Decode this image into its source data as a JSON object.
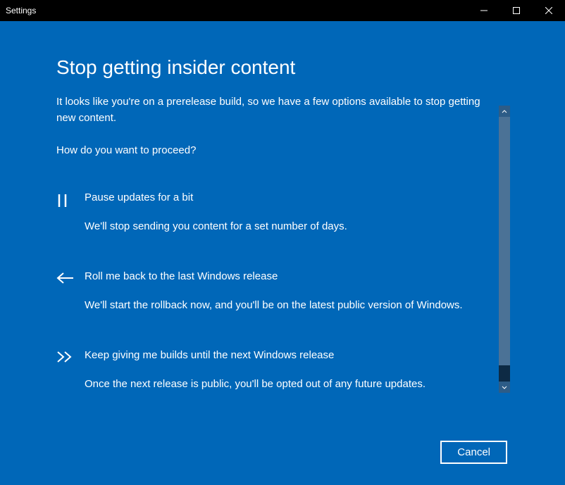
{
  "window": {
    "title": "Settings"
  },
  "page": {
    "title": "Stop getting insider content",
    "intro": "It looks like you're on a prerelease build, so we have a few options available to stop getting new content.",
    "prompt": "How do you want to proceed?"
  },
  "options": [
    {
      "title": "Pause updates for a bit",
      "desc": "We'll stop sending you content for a set number of days."
    },
    {
      "title": "Roll me back to the last Windows release",
      "desc": "We'll start the rollback now, and you'll be on the latest public version of Windows."
    },
    {
      "title": "Keep giving me builds until the next Windows release",
      "desc": "Once the next release is public, you'll be opted out of any future updates."
    }
  ],
  "footer": {
    "cancel_label": "Cancel"
  }
}
